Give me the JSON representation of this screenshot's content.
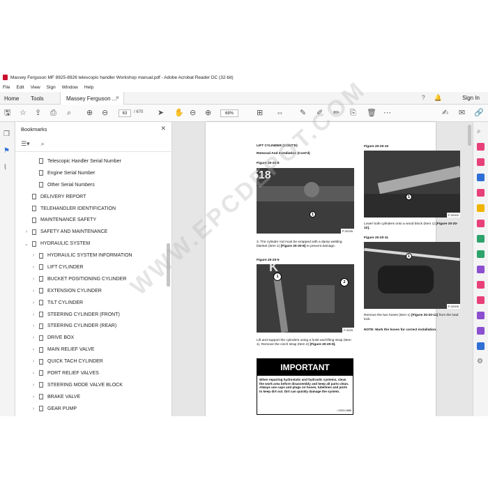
{
  "window": {
    "title": "Massey Ferguson MF 8925-8926 telescopic handler Workshop manual.pdf - Adobe Acrobat Reader DC (32-bit)"
  },
  "menu": [
    "File",
    "Edit",
    "View",
    "Sign",
    "Window",
    "Help"
  ],
  "tabs": {
    "home": "Home",
    "tools": "Tools",
    "document": "Massey Ferguson ..."
  },
  "sign_in": "Sign In",
  "toolbar": {
    "page_current": "63",
    "page_total": "/ 670",
    "zoom": "68%"
  },
  "bookmarks": {
    "title": "Bookmarks",
    "items": [
      {
        "label": "Telescopic Handler Serial Number",
        "level": 2,
        "expand": ""
      },
      {
        "label": "Engine Serial Number",
        "level": 2,
        "expand": ""
      },
      {
        "label": "Other Serial Numbers",
        "level": 2,
        "expand": ""
      },
      {
        "label": "DELIVERY REPORT",
        "level": 1,
        "expand": ""
      },
      {
        "label": "TELEHANDLER IDENTIFICATION",
        "level": 1,
        "expand": ""
      },
      {
        "label": "MAINTENANCE SAFETY",
        "level": 1,
        "expand": ""
      },
      {
        "label": "SAFETY AND MAINTENANCE",
        "level": 1,
        "expand": ">"
      },
      {
        "label": "HYDRAULIC SYSTEM",
        "level": 1,
        "expand": "v"
      },
      {
        "label": "HYDRAULIC SYSTEM INFORMATION",
        "level": 2,
        "expand": ">"
      },
      {
        "label": "LIFT CYLINDER",
        "level": 2,
        "expand": ">"
      },
      {
        "label": "BUCKET POSITIONING CYLINDER",
        "level": 2,
        "expand": ">"
      },
      {
        "label": "EXTENSION CYLINDER",
        "level": 2,
        "expand": ">"
      },
      {
        "label": "TILT CYLINDER",
        "level": 2,
        "expand": ">"
      },
      {
        "label": "STEERING CYLINDER (FRONT)",
        "level": 2,
        "expand": ">"
      },
      {
        "label": "STEERING CYLINDER (REAR)",
        "level": 2,
        "expand": ">"
      },
      {
        "label": "DRIVE BOX",
        "level": 2,
        "expand": ">"
      },
      {
        "label": "MAIN RELIEF VALVE",
        "level": 2,
        "expand": ">"
      },
      {
        "label": "QUICK TACH CYLINDER",
        "level": 2,
        "expand": ">"
      },
      {
        "label": "PORT RELIEF VALVES",
        "level": 2,
        "expand": ">"
      },
      {
        "label": "STEERING MODE VALVE BLOCK",
        "level": 2,
        "expand": ">"
      },
      {
        "label": "BRAKE VALVE",
        "level": 2,
        "expand": ">"
      },
      {
        "label": "GEAR PUMP",
        "level": 2,
        "expand": ">"
      }
    ]
  },
  "page": {
    "header": "LIFT CYLINDER (CONT'D)",
    "subheader": "Removal And Installation (Cont'd)",
    "fig8_caption": "Figure 20-20-8",
    "fig8_id": "P-32226",
    "fig8_plate": "518",
    "step3_num": "3.",
    "step3_text": "The cylinder rod must be wrapped with a damp welding blanket (Item 1)",
    "step3_ref": "[Figure 20-20-8]",
    "step3_tail": "to prevent damage.",
    "fig9_caption": "Figure 20-20-9",
    "fig9_id": "P-3233",
    "lift_text": "Lift and support the cylinders using a hoist and lifting strap (Item 1). Remove the cinch strap (Item 2)",
    "lift_ref": "[Figure 20-20-9].",
    "important_title": "IMPORTANT",
    "important_text": "When repairing hydrostatic and hydraulic systems, clean the work area before disassembly and keep all parts clean. Always use caps and plugs on hoses, tubelines and ports to keep dirt out. Dirt can quickly damage the system.",
    "important_code": "I-2003-0888",
    "fig10_caption": "Figure 20-20-10",
    "fig10_id": "P-32202",
    "lower_text": "Lower both cylinders onto a wood block (Item 1)",
    "lower_ref": "[Figure 20-20-10].",
    "fig11_caption": "Figure 20-20-11",
    "fig11_id": "P-32205",
    "remove_text": "Remove the two hoses (Item 1)",
    "remove_ref": "[Figure 20-20-11]",
    "remove_tail": "from the load lock.",
    "note": "NOTE: Mark the hoses for correct installation.",
    "callout_1": "1",
    "callout_2": "2"
  },
  "watermark": "WWW.EPCDEPOT.COM",
  "colors": {
    "acrobat_red": "#c8102e",
    "rail_pink": "#e8407a",
    "rail_blue": "#2f6fd6",
    "rail_purple": "#8b4fd0",
    "rail_green": "#2ea36b",
    "rail_yellow": "#f0b400"
  }
}
